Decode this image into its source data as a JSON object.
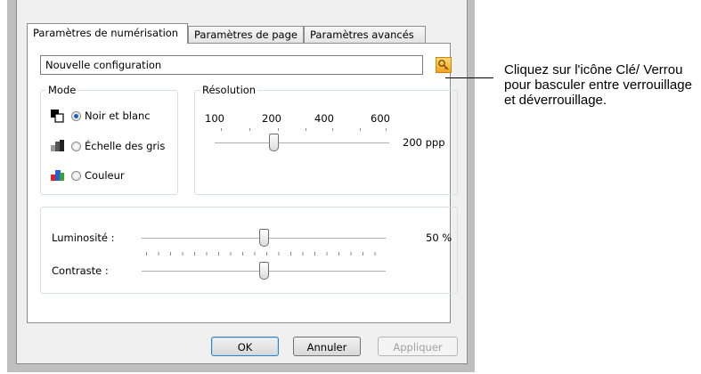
{
  "tabs": [
    {
      "label": "Paramètres de numérisation",
      "active": true
    },
    {
      "label": "Paramètres de page",
      "active": false
    },
    {
      "label": "Paramètres avancés",
      "active": false
    }
  ],
  "config": {
    "value": "Nouvelle configuration",
    "lock_icon": "key-lock-icon"
  },
  "mode": {
    "title": "Mode",
    "options": [
      {
        "label": "Noir et blanc",
        "checked": true,
        "icon": "black-white-mode-icon"
      },
      {
        "label": "Échelle des gris",
        "checked": false,
        "icon": "grayscale-mode-icon"
      },
      {
        "label": "Couleur",
        "checked": false,
        "icon": "color-mode-icon"
      }
    ]
  },
  "resolution": {
    "title": "Résolution",
    "ticks": [
      "100",
      "200",
      "400",
      "600"
    ],
    "value": 200,
    "value_label": "200 ppp"
  },
  "brightness": {
    "label": "Luminosité :",
    "value_percent": 50,
    "value_label": "50 %"
  },
  "contrast": {
    "label": "Contraste :",
    "value_percent": 50
  },
  "buttons": {
    "ok": "OK",
    "cancel": "Annuler",
    "apply": "Appliquer"
  },
  "callout": "Cliquez sur l'icône Clé/ Verrou pour basculer entre verrouillage et déverrouillage."
}
